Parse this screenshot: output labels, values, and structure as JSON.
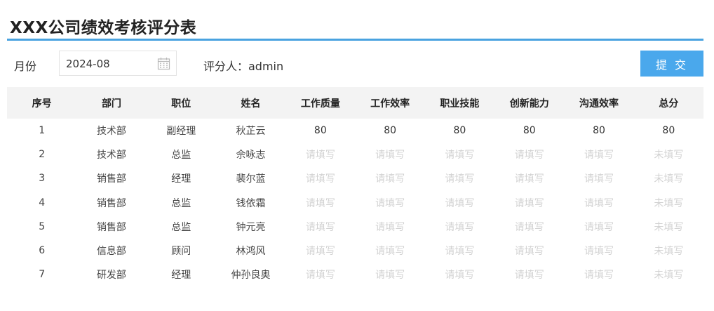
{
  "title": "XXX公司绩效考核评分表",
  "toolbar": {
    "month_label": "月份",
    "month_value": "2024-08",
    "rater": "评分人：admin",
    "submit_label": "提 交"
  },
  "colors": {
    "accent": "#4aa3e0",
    "button": "#4aa8ec",
    "placeholder_text": "#d2d2d2"
  },
  "table": {
    "headers": [
      "序号",
      "部门",
      "职位",
      "姓名",
      "工作质量",
      "工作效率",
      "职业技能",
      "创新能力",
      "沟通效率",
      "总分"
    ],
    "rows": [
      {
        "no": "1",
        "dept": "技术部",
        "position": "副经理",
        "name": "秋芷云",
        "quality": "80",
        "efficiency": "80",
        "skills": "80",
        "innovation": "80",
        "communication": "80",
        "total": "80"
      },
      {
        "no": "2",
        "dept": "技术部",
        "position": "总监",
        "name": "佘咏志",
        "quality": "请填写",
        "efficiency": "请填写",
        "skills": "请填写",
        "innovation": "请填写",
        "communication": "请填写",
        "total": "未填写"
      },
      {
        "no": "3",
        "dept": "销售部",
        "position": "经理",
        "name": "裴尔蓝",
        "quality": "请填写",
        "efficiency": "请填写",
        "skills": "请填写",
        "innovation": "请填写",
        "communication": "请填写",
        "total": "未填写"
      },
      {
        "no": "4",
        "dept": "销售部",
        "position": "总监",
        "name": "钱依霜",
        "quality": "请填写",
        "efficiency": "请填写",
        "skills": "请填写",
        "innovation": "请填写",
        "communication": "请填写",
        "total": "未填写"
      },
      {
        "no": "5",
        "dept": "销售部",
        "position": "总监",
        "name": "钟元亮",
        "quality": "请填写",
        "efficiency": "请填写",
        "skills": "请填写",
        "innovation": "请填写",
        "communication": "请填写",
        "total": "未填写"
      },
      {
        "no": "6",
        "dept": "信息部",
        "position": "顾问",
        "name": "林鸿风",
        "quality": "请填写",
        "efficiency": "请填写",
        "skills": "请填写",
        "innovation": "请填写",
        "communication": "请填写",
        "total": "未填写"
      },
      {
        "no": "7",
        "dept": "研发部",
        "position": "经理",
        "name": "仲孙良奥",
        "quality": "请填写",
        "efficiency": "请填写",
        "skills": "请填写",
        "innovation": "请填写",
        "communication": "请填写",
        "total": "未填写"
      }
    ]
  }
}
